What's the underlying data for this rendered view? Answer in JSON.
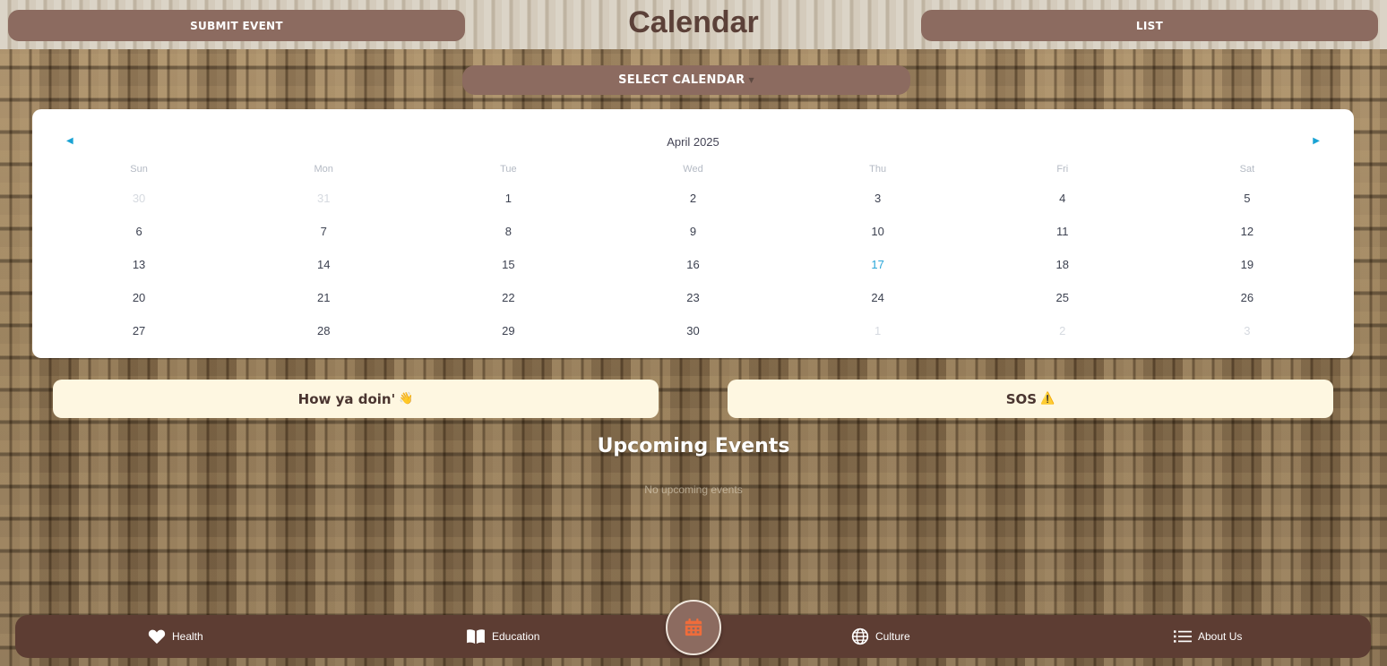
{
  "header": {
    "title": "Calendar",
    "submit_label": "SUBMIT EVENT",
    "list_label": "LIST",
    "select_calendar_label": "SELECT CALENDAR"
  },
  "calendar": {
    "month_label": "April 2025",
    "weekdays": [
      "Sun",
      "Mon",
      "Tue",
      "Wed",
      "Thu",
      "Fri",
      "Sat"
    ],
    "weeks": [
      [
        "30",
        "31",
        "1",
        "2",
        "3",
        "4",
        "5"
      ],
      [
        "6",
        "7",
        "8",
        "9",
        "10",
        "11",
        "12"
      ],
      [
        "13",
        "14",
        "15",
        "16",
        "17",
        "18",
        "19"
      ],
      [
        "20",
        "21",
        "22",
        "23",
        "24",
        "25",
        "26"
      ],
      [
        "27",
        "28",
        "29",
        "30",
        "1",
        "2",
        "3"
      ]
    ],
    "today": "17",
    "accent_color": "#2aa6d8"
  },
  "mood_buttons": {
    "howya_label": "How ya doin'",
    "howya_icon": "waving-hand-icon",
    "sos_label": "SOS",
    "sos_icon": "warning-icon"
  },
  "upcoming": {
    "title": "Upcoming Events",
    "empty_text": "No upcoming events"
  },
  "bottom_nav": {
    "items": [
      {
        "label": "Health",
        "icon": "heart-icon"
      },
      {
        "label": "Education",
        "icon": "book-icon"
      },
      {
        "label": "Culture",
        "icon": "globe-icon"
      },
      {
        "label": "About Us",
        "icon": "list-icon"
      }
    ],
    "center_icon": "calendar-icon"
  },
  "colors": {
    "button_brown": "#8c6b60",
    "nav_brown": "#5d3d33",
    "mood_cream": "#fef7e1",
    "title_brown": "#5b4038",
    "center_icon_orange": "#ef6c3b"
  }
}
